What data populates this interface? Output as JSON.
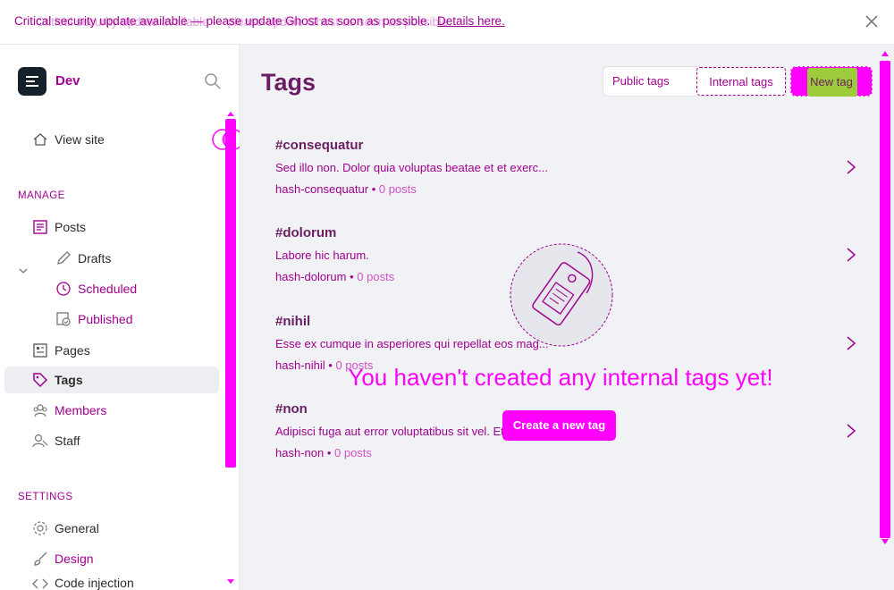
{
  "notification": {
    "message": "Critical security update available — please update Ghost as soon as possible.",
    "link": "Details here.",
    "close_icon": "close-icon"
  },
  "sidebar": {
    "site_name": "Dev",
    "view_site": "View site",
    "manage_label": "MANAGE",
    "items": {
      "posts": "Posts",
      "drafts": "Drafts",
      "scheduled": "Scheduled",
      "published": "Published",
      "pages": "Pages",
      "tags": "Tags",
      "members": "Members",
      "staff": "Staff"
    },
    "settings_label": "SETTINGS",
    "settings_items": {
      "general": "General",
      "design": "Design",
      "code_injection": "Code injection"
    }
  },
  "main": {
    "title": "Tags",
    "filter": {
      "public": "Public tags",
      "internal": "Internal tags"
    },
    "new_tag": "New tag",
    "tags": [
      {
        "name": "#consequatur",
        "description": "Sed illo non. Dolor quia voluptas beatae et et exerc...",
        "slug": "hash-consequatur",
        "count": "0 posts"
      },
      {
        "name": "#dolorum",
        "description": "Labore hic harum.",
        "slug": "hash-dolorum",
        "count": "0 posts"
      },
      {
        "name": "#nihil",
        "description": "Esse ex cumque in asperiores qui repellat eos mag...",
        "slug": "hash-nihil",
        "count": "0 posts"
      },
      {
        "name": "#non",
        "description": "Adipisci fuga aut error voluptatibus sit vel. Et e...",
        "slug": "hash-non",
        "count": "0 posts"
      }
    ],
    "empty_state": {
      "message": "You haven't created any internal tags yet!",
      "button": "Create a new tag"
    }
  },
  "colors": {
    "accent": "#ff00ff",
    "text_accent": "#a0008f",
    "title": "#6b1d63"
  }
}
